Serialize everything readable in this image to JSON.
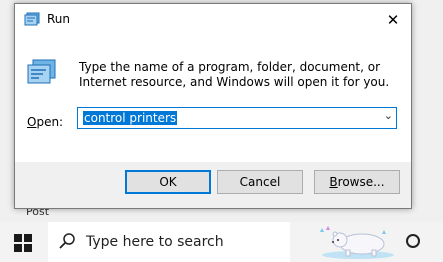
{
  "background": {
    "label": "Post"
  },
  "dialog": {
    "title": "Run",
    "close_glyph": "✕",
    "description": "Type the name of a program, folder, document, or Internet resource, and Windows will open it for you.",
    "open_label_accel": "O",
    "open_label_rest": "pen:",
    "open_value": "control printers",
    "dropdown_glyph": "⌄",
    "ok_label": "OK",
    "cancel_label": "Cancel",
    "browse_label_accel": "B",
    "browse_label_rest": "rowse...",
    "accent_color": "#0078d7",
    "icons": {
      "title": "run-icon",
      "body": "run-large-icon"
    }
  },
  "taskbar": {
    "search_placeholder": "Type here to search",
    "icons": [
      "windows-start-icon",
      "search-icon",
      "polar-bear-icon",
      "task-view-icon"
    ]
  }
}
